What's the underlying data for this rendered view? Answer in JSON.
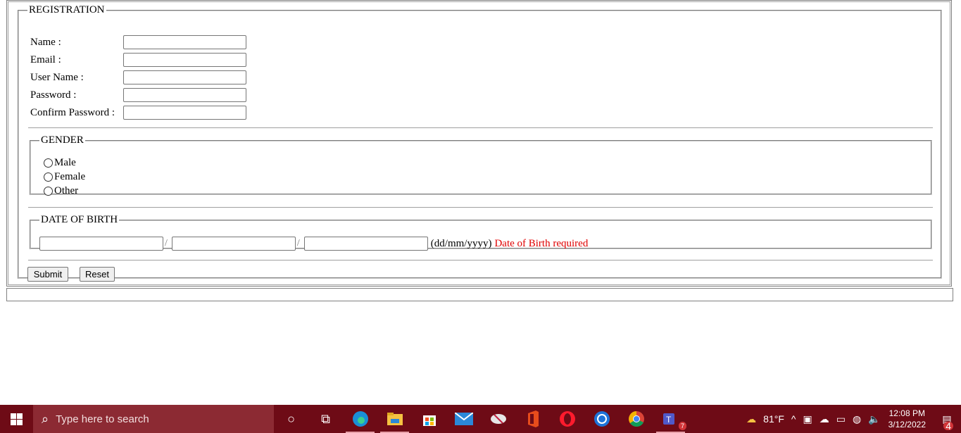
{
  "form": {
    "legend": "REGISTRATION",
    "fields": [
      {
        "label": "Name :",
        "value": ""
      },
      {
        "label": "Email :",
        "value": ""
      },
      {
        "label": "User Name :",
        "value": ""
      },
      {
        "label": "Password :",
        "value": ""
      },
      {
        "label": "Confirm Password :",
        "value": ""
      }
    ],
    "gender": {
      "legend": "GENDER",
      "options": [
        "Male",
        "Female",
        "Other"
      ]
    },
    "dob": {
      "legend": "DATE OF BIRTH",
      "separator": "/",
      "format_hint": "(dd/mm/yyyy)",
      "error": "Date of Birth required",
      "error_color": "#e00000"
    },
    "submit_label": "Submit",
    "reset_label": "Reset"
  },
  "taskbar": {
    "search_placeholder": "Type here to search",
    "weather": "81°F",
    "time": "12:08 PM",
    "date": "3/12/2022",
    "teams_badge": "7",
    "notification_badge": "4",
    "background": "#6e0b16"
  }
}
